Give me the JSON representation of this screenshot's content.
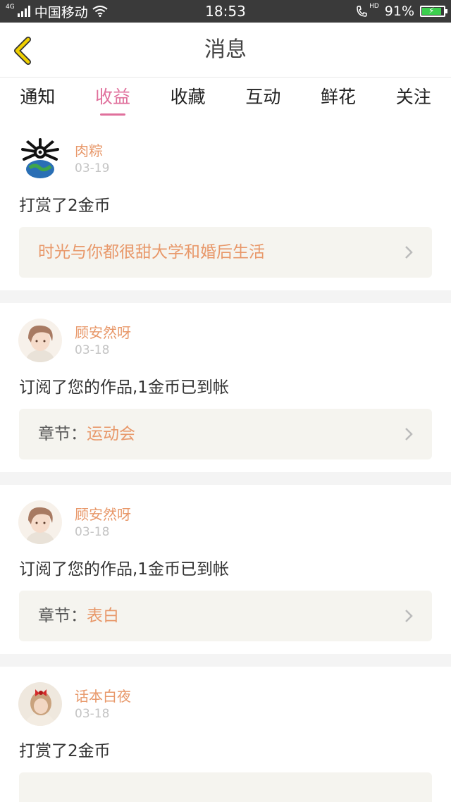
{
  "status_bar": {
    "carrier": "中国移动",
    "network": "4G",
    "time": "18:53",
    "hd": "HD",
    "battery": "91%",
    "battery_level": 0.91
  },
  "header": {
    "title": "消息"
  },
  "tabs": [
    {
      "label": "通知"
    },
    {
      "label": "收益",
      "active": true
    },
    {
      "label": "收藏"
    },
    {
      "label": "互动"
    },
    {
      "label": "鲜花"
    },
    {
      "label": "关注"
    }
  ],
  "feed": [
    {
      "user": "肉粽",
      "date": "03-19",
      "message": "打赏了2金币",
      "ref_prefix": "",
      "ref_title": "时光与你都很甜大学和婚后生活",
      "avatar_icon": "spider-globe-avatar"
    },
    {
      "user": "顾安然呀",
      "date": "03-18",
      "message": "订阅了您的作品,1金币已到帐",
      "ref_prefix": "章节：",
      "ref_title": "运动会",
      "avatar_icon": "anime-boy-avatar"
    },
    {
      "user": "顾安然呀",
      "date": "03-18",
      "message": "订阅了您的作品,1金币已到帐",
      "ref_prefix": "章节：",
      "ref_title": "表白",
      "avatar_icon": "anime-boy-avatar"
    },
    {
      "user": "话本白夜",
      "date": "03-18",
      "message": "打赏了2金币",
      "ref_prefix": "",
      "ref_title": "",
      "avatar_icon": "girl-red-bow-avatar"
    }
  ],
  "colors": {
    "accent_pink": "#e0709c",
    "name_orange": "#e8986a",
    "back_icon_yellow": "#f0d000",
    "status_bar_bg": "#3a3a3a"
  }
}
